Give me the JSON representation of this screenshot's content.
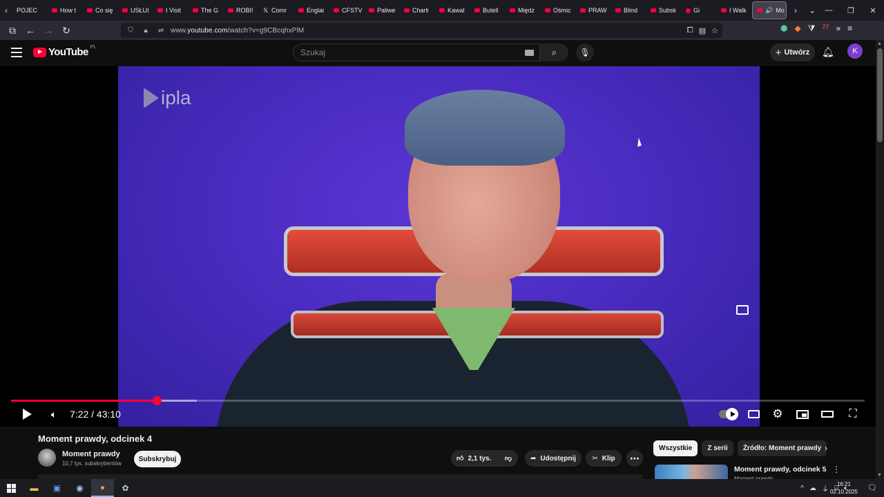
{
  "browser": {
    "tabs": [
      {
        "label": "POJEC",
        "fav": "none"
      },
      {
        "label": "How t",
        "fav": "yt"
      },
      {
        "label": "Co się",
        "fav": "yt"
      },
      {
        "label": "USŁUI",
        "fav": "yt"
      },
      {
        "label": "I Visit",
        "fav": "yt"
      },
      {
        "label": "The G",
        "fav": "yt"
      },
      {
        "label": "ROBI!",
        "fav": "yt"
      },
      {
        "label": "Comr",
        "fav": "x"
      },
      {
        "label": "Englai",
        "fav": "yt"
      },
      {
        "label": "CFSTV",
        "fav": "yt"
      },
      {
        "label": "Paliwe",
        "fav": "yt"
      },
      {
        "label": "Charli",
        "fav": "yt"
      },
      {
        "label": "Kawal",
        "fav": "yt"
      },
      {
        "label": "Butell",
        "fav": "yt"
      },
      {
        "label": "Międz",
        "fav": "yt"
      },
      {
        "label": "Ośmic",
        "fav": "yt"
      },
      {
        "label": "PRAW",
        "fav": "yt"
      },
      {
        "label": "Blind",
        "fav": "yt"
      },
      {
        "label": "Subsk",
        "fav": "yt"
      },
      {
        "label": "Gi",
        "fav": "rec"
      },
      {
        "label": "I Walk",
        "fav": "yt"
      }
    ],
    "active_tab": {
      "label": "Mo"
    },
    "url_prefix": "www.",
    "url_host": "youtube.com",
    "url_path": "/watch?v=g9CBcqhxPlM",
    "ext_badge": "77"
  },
  "youtube": {
    "logo_text": "YouTube",
    "country_code": "PL",
    "search_placeholder": "Szukaj",
    "create_label": "Utwórz",
    "avatar_letter": "K"
  },
  "player": {
    "watermark": "ipla",
    "current_time": "7:22",
    "duration": "43:10",
    "time_display": "7:22 / 43:10",
    "progress_fraction": 0.171,
    "buffered_fraction": 0.218
  },
  "video": {
    "title": "Moment prawdy, odcinek 4",
    "channel_name": "Moment prawdy",
    "channel_subs": "10,7 tys. subskrybentów",
    "subscribe_label": "Subskrybuj",
    "likes": "2,1 tys.",
    "share_label": "Udostępnij",
    "clip_label": "Klip"
  },
  "sidebar": {
    "chips": [
      {
        "label": "Wszystkie",
        "selected": true
      },
      {
        "label": "Z serii",
        "selected": false
      },
      {
        "label": "Źródło: Moment prawdy",
        "selected": false
      }
    ],
    "rec": {
      "title": "Moment prawdy, odcinek 5",
      "channel": "Moment prawdy"
    }
  },
  "taskbar": {
    "time": "16:21",
    "date": "02.10.2025"
  },
  "colors": {
    "yt_red": "#ff0033",
    "accent_purple": "#7b3fcf",
    "bg": "#0f0f0f"
  }
}
